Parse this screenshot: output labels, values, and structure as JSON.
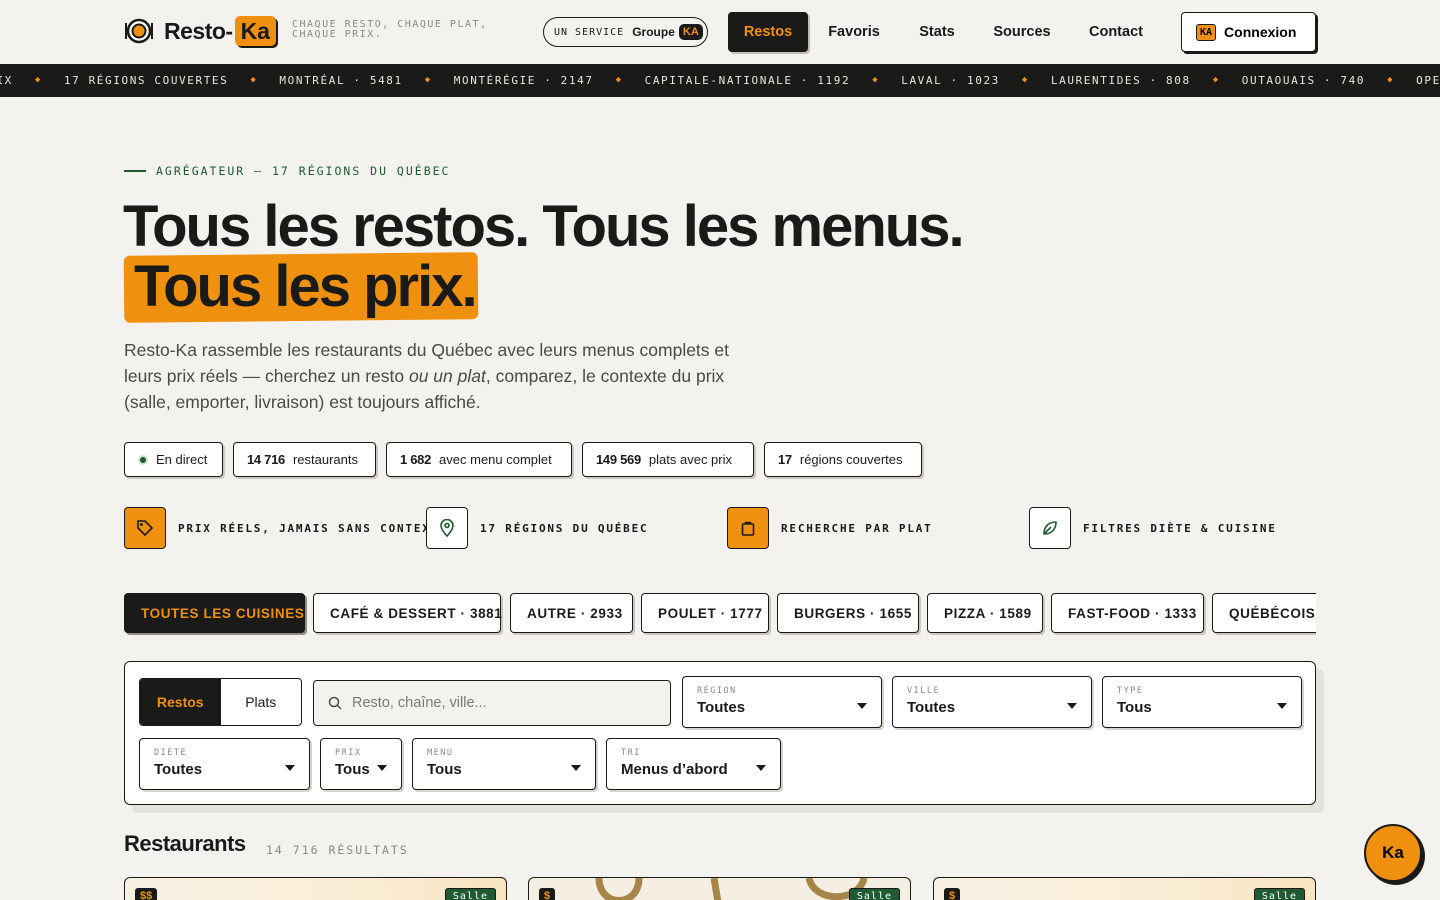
{
  "header": {
    "logo_text": "Resto-",
    "logo_ka": "Ka",
    "tagline": "CHAQUE RESTO, CHAQUE PLAT, CHAQUE PRIX.",
    "service_prefix": "UN SERVICE",
    "service_groupe": "Groupe",
    "service_ka": "KA",
    "nav": [
      "Restos",
      "Favoris",
      "Stats",
      "Sources",
      "Contact"
    ],
    "connexion_badge": "KA",
    "connexion_label": "Connexion"
  },
  "ticker": [
    "PRIX",
    "17 RÉGIONS COUVERTES",
    "MONTRÉAL · 5481",
    "MONTÉRÉGIE · 2147",
    "CAPITALE-NATIONALE · 1192",
    "LAVAL · 1023",
    "LAURENTIDES · 808",
    "OUTAOUAIS · 740",
    "OPENSTREETMAP"
  ],
  "hero": {
    "eyebrow": "AGRÉGATEUR — 17 RÉGIONS DU QUÉBEC",
    "title_line1": "Tous les restos. Tous les menus.",
    "title_line2": "Tous les prix.",
    "lead_part1": "Resto-Ka rassemble les restaurants du Québec avec leurs menus complets et leurs prix réels — cherchez un resto ",
    "lead_em": "ou un plat",
    "lead_part2": ", comparez, le contexte du prix (salle, emporter, livraison) est toujours affiché."
  },
  "stats": {
    "live": "En direct",
    "items": [
      {
        "value": "14 716",
        "label": "restaurants"
      },
      {
        "value": "1 682",
        "label": "avec menu complet"
      },
      {
        "value": "149 569",
        "label": "plats avec prix"
      },
      {
        "value": "17",
        "label": "régions couvertes"
      }
    ]
  },
  "features": [
    {
      "label": "PRIX RÉELS, JAMAIS SANS CONTEXTE",
      "icon": "tag-icon"
    },
    {
      "label": "17 RÉGIONS DU QUÉBEC",
      "icon": "map-pin-icon"
    },
    {
      "label": "RECHERCHE PAR PLAT",
      "icon": "bag-icon"
    },
    {
      "label": "FILTRES DIÈTE & CUISINE",
      "icon": "leaf-icon"
    }
  ],
  "cuisines": [
    "TOUTES LES CUISINES",
    "CAFÉ & DESSERT · 3881",
    "AUTRE · 2933",
    "POULET · 1777",
    "BURGERS · 1655",
    "PIZZA · 1589",
    "FAST-FOOD · 1333",
    "QUÉBÉCOIS ·"
  ],
  "search": {
    "mode_restos": "Restos",
    "mode_plats": "Plats",
    "placeholder": "Resto, chaîne, ville...",
    "filters": {
      "region": {
        "label": "RÉGION",
        "value": "Toutes"
      },
      "ville": {
        "label": "VILLE",
        "value": "Toutes"
      },
      "type": {
        "label": "TYPE",
        "value": "Tous"
      },
      "diete": {
        "label": "DIÈTE",
        "value": "Toutes"
      },
      "prix": {
        "label": "PRIX",
        "value": "Tous"
      },
      "menu": {
        "label": "MENU",
        "value": "Tous"
      },
      "tri": {
        "label": "TRI",
        "value": "Menus d’abord"
      }
    }
  },
  "results": {
    "title": "Restaurants",
    "count": "14 716 RÉSULTATS",
    "cards": [
      {
        "price": "$$",
        "mode": "Salle"
      },
      {
        "price": "$",
        "mode": "Salle"
      },
      {
        "price": "$",
        "mode": "Salle"
      }
    ]
  },
  "fab": "Ka",
  "colors": {
    "accent": "#f0900f",
    "dark": "#1a1a18",
    "green": "#1f5a33",
    "bg": "#f3f2ee"
  }
}
